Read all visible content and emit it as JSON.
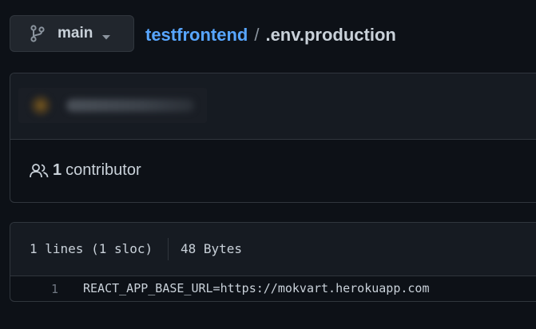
{
  "branch": {
    "icon": "git-branch-icon",
    "label": "main",
    "caret_icon": "triangle-down-icon"
  },
  "breadcrumb": {
    "repo": "testfrontend",
    "separator": "/",
    "file": ".env.production"
  },
  "commit": {
    "avatar_icon": "avatar-blurred",
    "contributors_icon": "people-icon",
    "contributors_count": "1",
    "contributors_label": "contributor"
  },
  "file": {
    "lines_info": "1 lines (1 sloc)",
    "size": "48 Bytes",
    "code": [
      {
        "line": "1",
        "text": "REACT_APP_BASE_URL=https://mokvart.herokuapp.com"
      }
    ]
  },
  "colors": {
    "background": "#0d1117",
    "link": "#58a6ff",
    "border": "#30363d",
    "header_bg": "#161b22"
  }
}
